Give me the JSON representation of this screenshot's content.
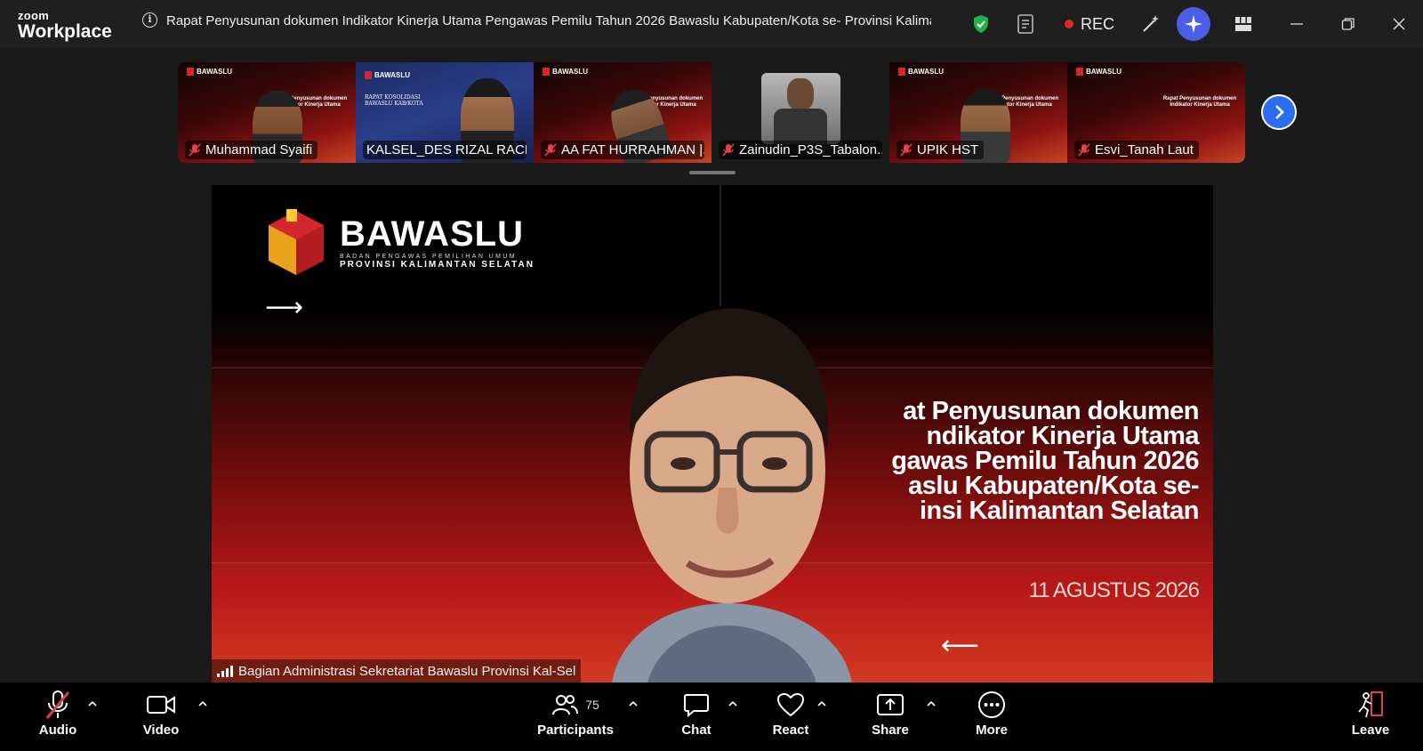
{
  "app": {
    "brand_small": "zoom",
    "brand_large": "Workplace",
    "meeting_title": "Rapat Penyusunan dokumen Indikator Kinerja Utama Pengawas Pemilu Tahun 2026 Bawaslu Kabupaten/Kota se- Provinsi Kalimanta",
    "rec_label": "REC"
  },
  "gallery": {
    "tiles": [
      {
        "name": "Muhammad Syaifi"
      },
      {
        "name": "KALSEL_DES RIZAL RACH..."
      },
      {
        "name": "AA FAT HURRAHMAN |..."
      },
      {
        "name": "Zainudin_P3S_Tabalon..."
      },
      {
        "name": "UPIK HST"
      },
      {
        "name": "Esvi_Tanah Laut"
      }
    ]
  },
  "main_video": {
    "logo_name": "BAWASLU",
    "logo_sub": "BADAN PENGAWAS PEMILIHAN UMUM",
    "logo_prov": "PROVINSI KALIMANTAN SELATAN",
    "slide_title": "at Penyusunan dokumen\nndikator Kinerja Utama\ngawas Pemilu Tahun 2026\naslu Kabupaten/Kota se-\ninsi Kalimantan Selatan",
    "slide_date": "11 AGUSTUS 2026",
    "speaker_name": "Bagian Administrasi Sekretariat Bawaslu Provinsi Kal-Sel"
  },
  "toolbar": {
    "audio": "Audio",
    "video": "Video",
    "participants": "Participants",
    "participants_count": "75",
    "chat": "Chat",
    "react": "React",
    "share": "Share",
    "more": "More",
    "leave": "Leave"
  },
  "colors": {
    "accent": "#2b6df0",
    "rec": "#e02828",
    "ai": "#4b5ee8",
    "mute": "#e0404a",
    "slide_red": "#b41818"
  }
}
